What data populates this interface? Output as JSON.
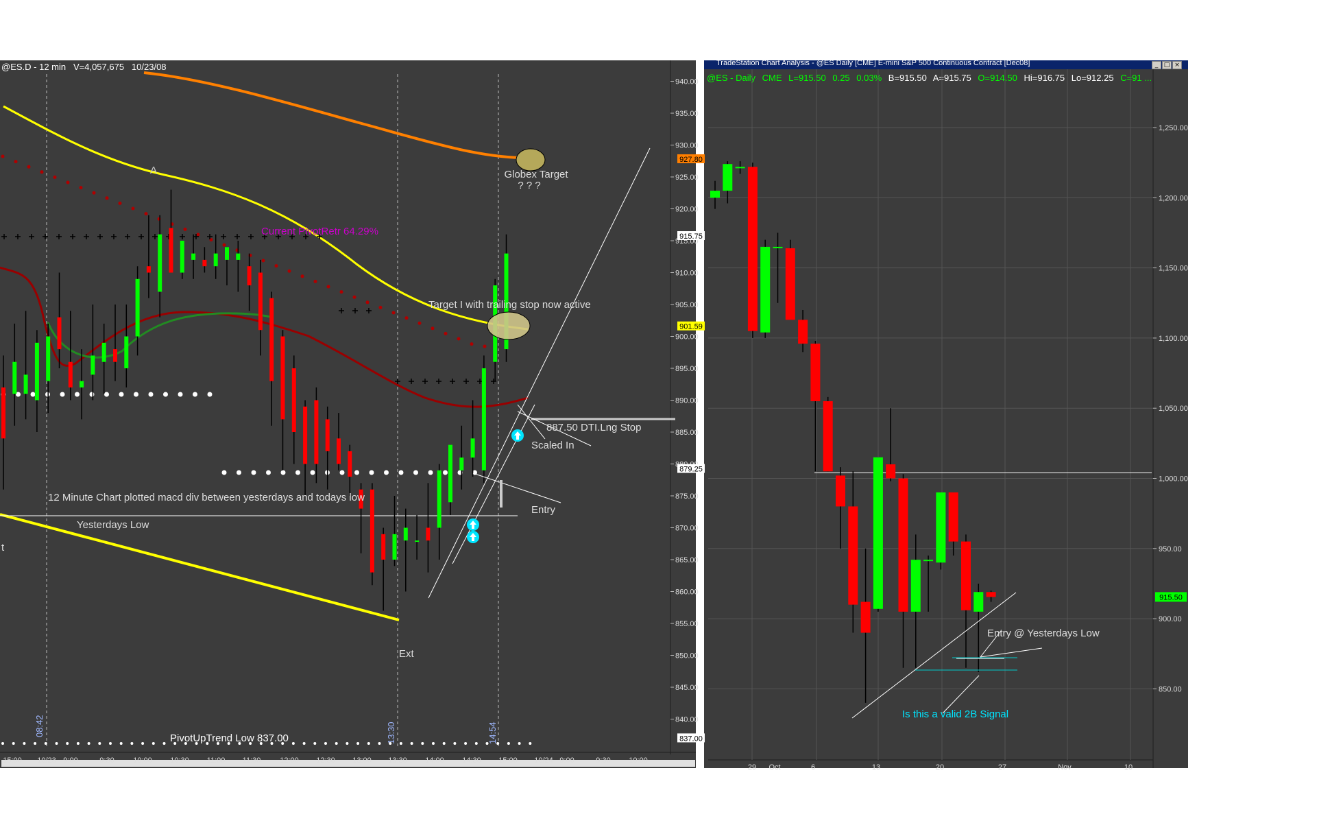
{
  "left_chart": {
    "header": {
      "symbol": "@ES.D - 12 min",
      "volume": "V=4,057,675",
      "date": "10/23/08"
    },
    "price_ticks": [
      "940.00",
      "935.00",
      "930.00",
      "925.00",
      "920.00",
      "915.00",
      "910.00",
      "905.00",
      "900.00",
      "895.00",
      "890.00",
      "885.00",
      "880.00",
      "875.00",
      "870.00",
      "865.00",
      "860.00",
      "855.00",
      "850.00",
      "845.00",
      "840.00"
    ],
    "time_ticks": [
      "15:00",
      "10/23",
      "9:00",
      "9:30",
      "10:00",
      "10:30",
      "11:00",
      "11:30",
      "12:00",
      "12:30",
      "13:00",
      "13:30",
      "14:00",
      "14:30",
      "15:00",
      "10/24",
      "9:00",
      "9:30",
      "10:00"
    ],
    "price_markers": [
      {
        "value": "927.80",
        "color": "#ff7f00"
      },
      {
        "value": "915.75",
        "color": "#ffffff"
      },
      {
        "value": "901.59",
        "color": "#ffff00"
      },
      {
        "value": "879.25",
        "color": "#ffffff"
      },
      {
        "value": "837.00",
        "color": "#ffffff"
      }
    ],
    "vertical_time_labels": [
      "08:42",
      "13:30",
      "14:54"
    ],
    "annotations": {
      "a_label": "A",
      "globex_target": "Globex Target",
      "question_marks": "? ? ?",
      "current_pivot": "Current PivotRetr 64.29%",
      "target_one": "Target I with trailing stop now active",
      "stop_label": "887.50 DTI.Lng Stop",
      "scaled_in": "Scaled In",
      "macd_note": "12 Minute Chart plotted macd div between yesterdays and todays low",
      "entry": "Entry",
      "yesterdays_low": "Yesterdays Low",
      "t_label": "t",
      "ext": "Ext",
      "pivot_uptrend_low": "PivotUpTrend Low 837.00"
    }
  },
  "right_chart": {
    "window_title": "TradeStation Chart Analysis - @ES  Daily  [CME] E-mini S&P 500 Continuous Contract [Dec08]",
    "header": {
      "symbol": "@ES - Daily",
      "exchange": "CME",
      "last": "L=915.50",
      "change": "0.25",
      "pct": "0.03%",
      "bid": "B=915.50",
      "ask": "A=915.75",
      "open": "O=914.50",
      "high": "Hi=916.75",
      "low": "Lo=912.25",
      "close": "C=91 ..."
    },
    "price_ticks": [
      "1,250.00",
      "1,200.00",
      "1,150.00",
      "1,100.00",
      "1,050.00",
      "1,000.00",
      "950.00",
      "900.00",
      "850.00"
    ],
    "date_ticks": [
      "29",
      "Oct",
      "6",
      "13",
      "20",
      "27",
      "Nov",
      "10"
    ],
    "last_price_marker": "915.50",
    "annotations": {
      "entry_yesterdays_low": "Entry @ Yesterdays Low",
      "valid_2b": "Is this a valid 2B Signal"
    }
  },
  "chart_data": [
    {
      "type": "candlestick",
      "title": "@ES.D - 12 min",
      "ylim": [
        837,
        942
      ],
      "levels": {
        "yesterdays_low": 873,
        "pivot_uptrend_low": 837.0,
        "entry_line": 879.25,
        "dti_stop": 887.5
      },
      "candles": [
        {
          "o": 892,
          "h": 897,
          "l": 876,
          "c": 884
        },
        {
          "o": 891,
          "h": 902,
          "l": 886,
          "c": 896
        },
        {
          "o": 891,
          "h": 904,
          "l": 887,
          "c": 894
        },
        {
          "o": 890,
          "h": 901,
          "l": 885,
          "c": 899
        },
        {
          "o": 893,
          "h": 902,
          "l": 888,
          "c": 900
        },
        {
          "o": 903,
          "h": 910,
          "l": 895,
          "c": 898
        },
        {
          "o": 896,
          "h": 904,
          "l": 890,
          "c": 892
        },
        {
          "o": 892,
          "h": 898,
          "l": 887,
          "c": 893
        },
        {
          "o": 894,
          "h": 905,
          "l": 890,
          "c": 897
        },
        {
          "o": 896,
          "h": 902,
          "l": 891,
          "c": 899
        },
        {
          "o": 898,
          "h": 905,
          "l": 893,
          "c": 896
        },
        {
          "o": 895,
          "h": 905,
          "l": 892,
          "c": 900
        },
        {
          "o": 900,
          "h": 911,
          "l": 897,
          "c": 909
        },
        {
          "o": 911,
          "h": 919,
          "l": 906,
          "c": 910
        },
        {
          "o": 907,
          "h": 919,
          "l": 903,
          "c": 916
        },
        {
          "o": 917,
          "h": 923,
          "l": 911,
          "c": 910
        },
        {
          "o": 910,
          "h": 914,
          "l": 909,
          "c": 915
        },
        {
          "o": 912,
          "h": 916,
          "l": 909,
          "c": 913
        },
        {
          "o": 912,
          "h": 914,
          "l": 910,
          "c": 911
        },
        {
          "o": 911,
          "h": 916,
          "l": 909,
          "c": 913
        },
        {
          "o": 912,
          "h": 914,
          "l": 908,
          "c": 914
        },
        {
          "o": 912,
          "h": 915,
          "l": 907,
          "c": 913
        },
        {
          "o": 911,
          "h": 913,
          "l": 904,
          "c": 908
        },
        {
          "o": 910,
          "h": 912,
          "l": 897,
          "c": 901
        },
        {
          "o": 906,
          "h": 907,
          "l": 886,
          "c": 893
        },
        {
          "o": 900,
          "h": 901,
          "l": 879,
          "c": 887
        },
        {
          "o": 895,
          "h": 897,
          "l": 880,
          "c": 885
        },
        {
          "o": 889,
          "h": 890,
          "l": 875,
          "c": 880
        },
        {
          "o": 890,
          "h": 892,
          "l": 877,
          "c": 880
        },
        {
          "o": 887,
          "h": 889,
          "l": 876,
          "c": 882
        },
        {
          "o": 884,
          "h": 888,
          "l": 879,
          "c": 880
        },
        {
          "o": 882,
          "h": 883,
          "l": 875,
          "c": 878
        },
        {
          "o": 876,
          "h": 877,
          "l": 866,
          "c": 873
        },
        {
          "o": 876,
          "h": 877,
          "l": 861,
          "c": 863
        },
        {
          "o": 869,
          "h": 870,
          "l": 857,
          "c": 865
        },
        {
          "o": 865,
          "h": 875,
          "l": 864,
          "c": 869
        },
        {
          "o": 868,
          "h": 873,
          "l": 860,
          "c": 870
        },
        {
          "o": 868,
          "h": 872,
          "l": 865,
          "c": 868
        },
        {
          "o": 870,
          "h": 877,
          "l": 863,
          "c": 868
        },
        {
          "o": 870,
          "h": 880,
          "l": 865,
          "c": 879
        },
        {
          "o": 874,
          "h": 883,
          "l": 872,
          "c": 883
        },
        {
          "o": 879,
          "h": 886,
          "l": 876,
          "c": 881
        },
        {
          "o": 881,
          "h": 890,
          "l": 878,
          "c": 884
        },
        {
          "o": 879,
          "h": 897,
          "l": 877,
          "c": 895
        },
        {
          "o": 896,
          "h": 909,
          "l": 893,
          "c": 908
        },
        {
          "o": 898,
          "h": 916,
          "l": 896,
          "c": 913
        }
      ]
    },
    {
      "type": "candlestick",
      "title": "@ES - Daily",
      "ylim": [
        825,
        1275
      ],
      "x": [
        "9/24",
        "9/25",
        "9/26",
        "9/29",
        "9/30",
        "10/1",
        "10/2",
        "10/3",
        "10/6",
        "10/7",
        "10/8",
        "10/9",
        "10/10",
        "10/13",
        "10/14",
        "10/15",
        "10/16",
        "10/17",
        "10/20",
        "10/21",
        "10/22",
        "10/23",
        "10/24"
      ],
      "candles": [
        {
          "o": 1200,
          "h": 1212,
          "l": 1192,
          "c": 1205
        },
        {
          "o": 1205,
          "h": 1226,
          "l": 1196,
          "c": 1224
        },
        {
          "o": 1221,
          "h": 1226,
          "l": 1217,
          "c": 1222
        },
        {
          "o": 1222,
          "h": 1225,
          "l": 1100,
          "c": 1105
        },
        {
          "o": 1104,
          "h": 1170,
          "l": 1100,
          "c": 1165
        },
        {
          "o": 1165,
          "h": 1175,
          "l": 1125,
          "c": 1165
        },
        {
          "o": 1164,
          "h": 1170,
          "l": 1115,
          "c": 1113
        },
        {
          "o": 1113,
          "h": 1120,
          "l": 1090,
          "c": 1096
        },
        {
          "o": 1096,
          "h": 1098,
          "l": 1005,
          "c": 1055
        },
        {
          "o": 1055,
          "h": 1058,
          "l": 1005,
          "c": 1005
        },
        {
          "o": 1002,
          "h": 1008,
          "l": 950,
          "c": 980
        },
        {
          "o": 980,
          "h": 1005,
          "l": 890,
          "c": 910
        },
        {
          "o": 912,
          "h": 950,
          "l": 840,
          "c": 890
        },
        {
          "o": 907,
          "h": 1015,
          "l": 905,
          "c": 1015
        },
        {
          "o": 1010,
          "h": 1050,
          "l": 998,
          "c": 1000
        },
        {
          "o": 1000,
          "h": 1003,
          "l": 865,
          "c": 905
        },
        {
          "o": 905,
          "h": 960,
          "l": 865,
          "c": 942
        },
        {
          "o": 942,
          "h": 945,
          "l": 905,
          "c": 942
        },
        {
          "o": 940,
          "h": 990,
          "l": 935,
          "c": 990
        },
        {
          "o": 990,
          "h": 990,
          "l": 945,
          "c": 955
        },
        {
          "o": 955,
          "h": 960,
          "l": 865,
          "c": 906
        },
        {
          "o": 905,
          "h": 925,
          "l": 862,
          "c": 919
        },
        {
          "o": 919,
          "h": 920,
          "l": 912,
          "c": 915.5
        }
      ],
      "levels": {
        "horizontal_line": 1004
      }
    }
  ]
}
